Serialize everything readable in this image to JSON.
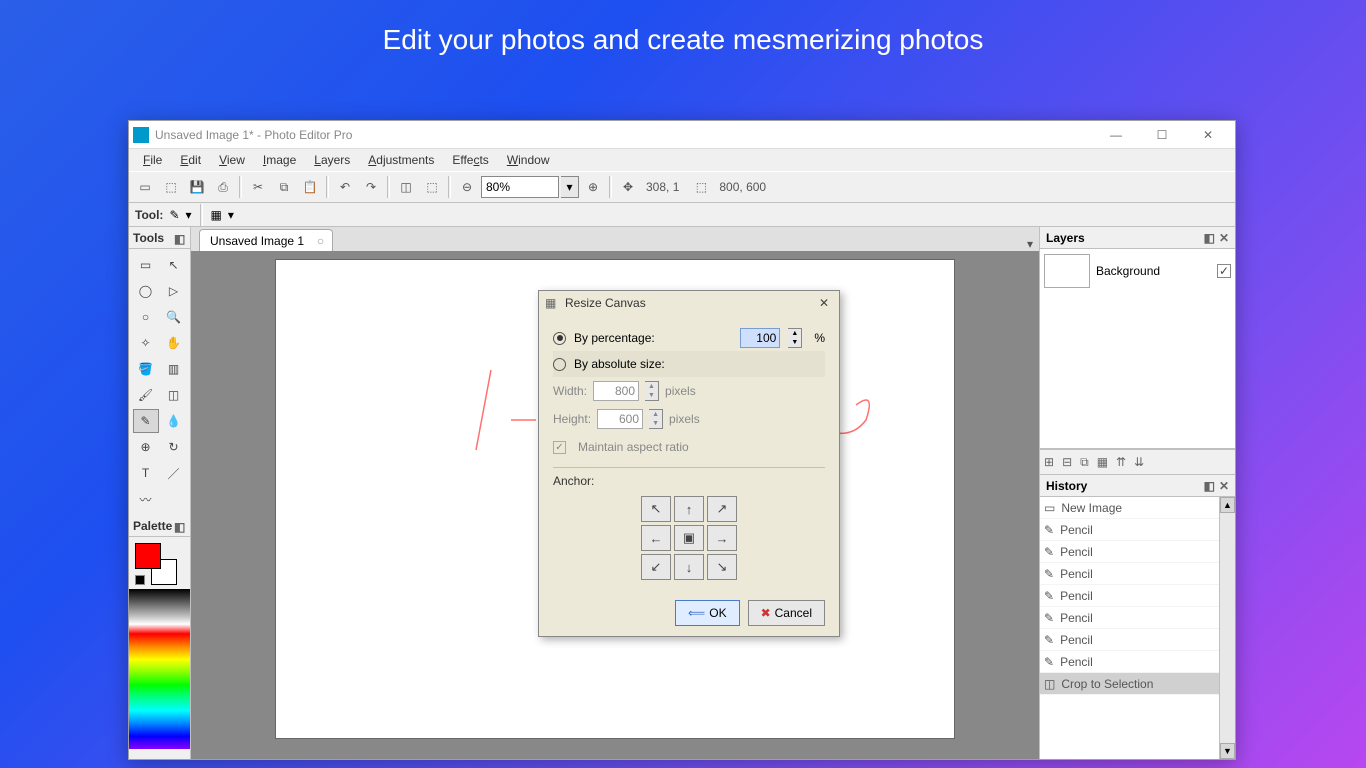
{
  "banner": "Edit your photos and create mesmerizing photos",
  "window": {
    "title": "Unsaved Image 1* - Photo Editor Pro",
    "menus": [
      "File",
      "Edit",
      "View",
      "Image",
      "Layers",
      "Adjustments",
      "Effects",
      "Window"
    ],
    "zoom": "80%",
    "cursor_pos": "308, 1",
    "canvas_size": "800, 600",
    "toolrow_label": "Tool:"
  },
  "tabs": {
    "active": "Unsaved Image 1"
  },
  "panels": {
    "tools_title": "Tools",
    "palette_title": "Palette",
    "layers_title": "Layers",
    "history_title": "History"
  },
  "layers": {
    "items": [
      {
        "name": "Background"
      }
    ]
  },
  "history": {
    "items": [
      "New Image",
      "Pencil",
      "Pencil",
      "Pencil",
      "Pencil",
      "Pencil",
      "Pencil",
      "Pencil",
      "Crop to Selection"
    ]
  },
  "dialog": {
    "title": "Resize Canvas",
    "by_percentage": "By percentage:",
    "by_absolute": "By absolute size:",
    "percentage_value": "100",
    "percent_suffix": "%",
    "width_label": "Width:",
    "width_value": "800",
    "height_label": "Height:",
    "height_value": "600",
    "pixels": "pixels",
    "maintain": "Maintain aspect ratio",
    "anchor_label": "Anchor:",
    "ok": "OK",
    "cancel": "Cancel"
  },
  "palette": {
    "fg": "#ff0000",
    "bg": "#ffffff"
  }
}
